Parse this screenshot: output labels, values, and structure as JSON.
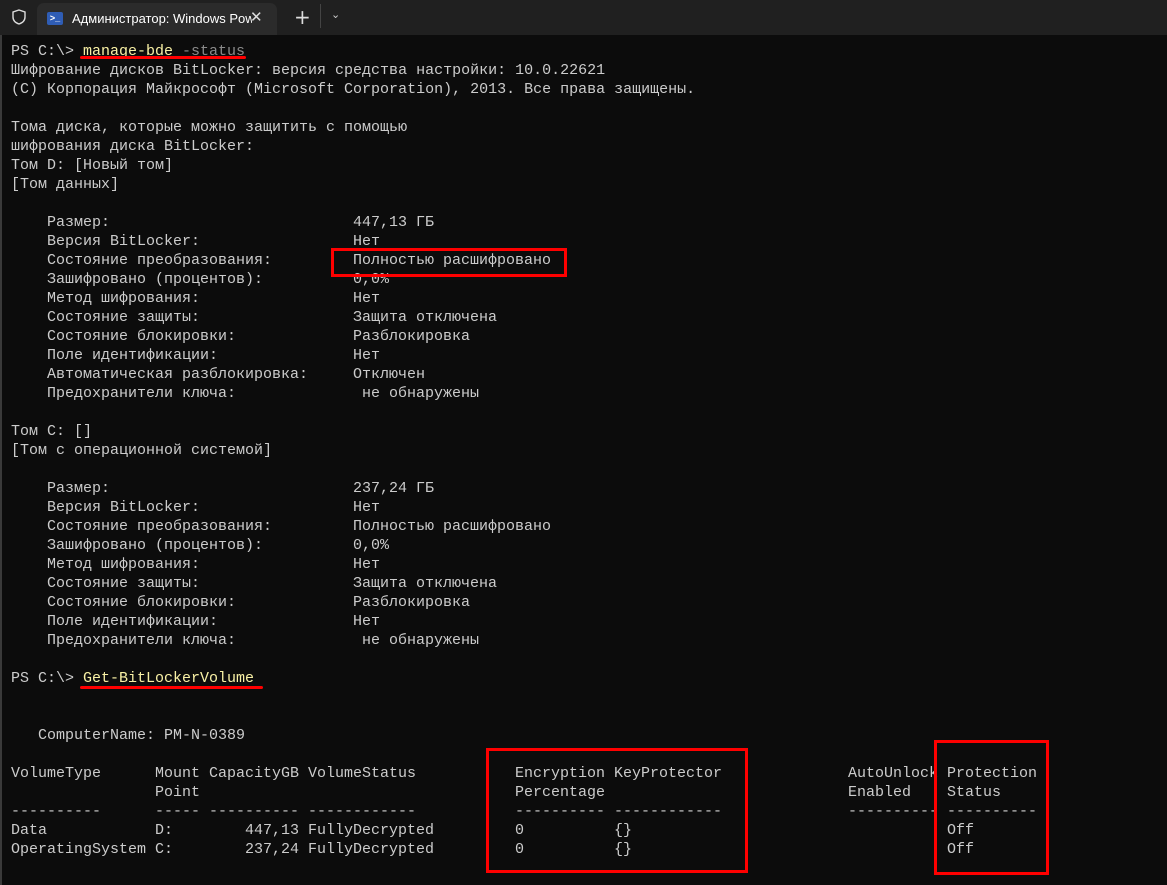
{
  "tab": {
    "title": "Администратор: Windows PowerShell",
    "close": "✕",
    "icon": "powershell-icon"
  },
  "tabbar": {
    "new_tab": "+",
    "dropdown": "⌄"
  },
  "cmd1": {
    "prompt": "PS C:\\> ",
    "command": "manage-bde",
    "param": " -status"
  },
  "intro": [
    "Шифрование дисков BitLocker: версия средства настройки: 10.0.22621",
    "(C) Корпорация Майкрософт (Microsoft Corporation), 2013. Все права защищены.",
    "",
    "Тома диска, которые можно защитить с помощью",
    "шифрования диска BitLocker:",
    "Том D: [Новый том]",
    "[Том данных]"
  ],
  "volD": [
    {
      "label": "Размер:",
      "value": "447,13 ГБ"
    },
    {
      "label": "Версия BitLocker:",
      "value": "Нет"
    },
    {
      "label": "Состояние преобразования:",
      "value": "Полностью расшифровано"
    },
    {
      "label": "Зашифровано (процентов):",
      "value": "0,0%"
    },
    {
      "label": "Метод шифрования:",
      "value": "Нет"
    },
    {
      "label": "Состояние защиты:",
      "value": "Защита отключена"
    },
    {
      "label": "Состояние блокировки:",
      "value": "Разблокировка"
    },
    {
      "label": "Поле идентификации:",
      "value": "Нет"
    },
    {
      "label": "Автоматическая разблокировка:",
      "value": "Отключен"
    },
    {
      "label": "Предохранители ключа:",
      "value": "не обнаружены"
    }
  ],
  "volC_head": [
    "Том C: []",
    "[Том с операционной системой]"
  ],
  "volC": [
    {
      "label": "Размер:",
      "value": "237,24 ГБ"
    },
    {
      "label": "Версия BitLocker:",
      "value": "Нет"
    },
    {
      "label": "Состояние преобразования:",
      "value": "Полностью расшифровано"
    },
    {
      "label": "Зашифровано (процентов):",
      "value": "0,0%"
    },
    {
      "label": "Метод шифрования:",
      "value": "Нет"
    },
    {
      "label": "Состояние защиты:",
      "value": "Защита отключена"
    },
    {
      "label": "Состояние блокировки:",
      "value": "Разблокировка"
    },
    {
      "label": "Поле идентификации:",
      "value": "Нет"
    },
    {
      "label": "Предохранители ключа:",
      "value": "не обнаружены"
    }
  ],
  "cmd2": {
    "prompt": "PS C:\\> ",
    "command": "Get-BitLockerVolume"
  },
  "computer": "   ComputerName: PM-N-0389",
  "table": {
    "columns": [
      {
        "h1": "VolumeType",
        "h2": "",
        "dash": "----------"
      },
      {
        "h1": "Mount",
        "h2": "Point",
        "dash": "-----"
      },
      {
        "h1": "CapacityGB",
        "h2": "",
        "dash": "----------"
      },
      {
        "h1": "VolumeStatus",
        "h2": "",
        "dash": "------------"
      },
      {
        "h1": "Encryption",
        "h2": "Percentage",
        "dash": "----------"
      },
      {
        "h1": "KeyProtector",
        "h2": "",
        "dash": "------------"
      },
      {
        "h1": "AutoUnlock",
        "h2": "Enabled",
        "dash": "----------"
      },
      {
        "h1": "Protection",
        "h2": "Status",
        "dash": "----------"
      }
    ],
    "rows": [
      [
        "Data",
        "D:",
        "447,13",
        "FullyDecrypted",
        "0",
        "{}",
        "",
        "Off"
      ],
      [
        "OperatingSystem",
        "C:",
        "237,24",
        "FullyDecrypted",
        "0",
        "{}",
        "",
        "Off"
      ]
    ]
  },
  "colors": {
    "background": "#0c0c0c",
    "text": "#cccccc",
    "command": "#f9f1a5",
    "annotation": "#ff0000"
  }
}
